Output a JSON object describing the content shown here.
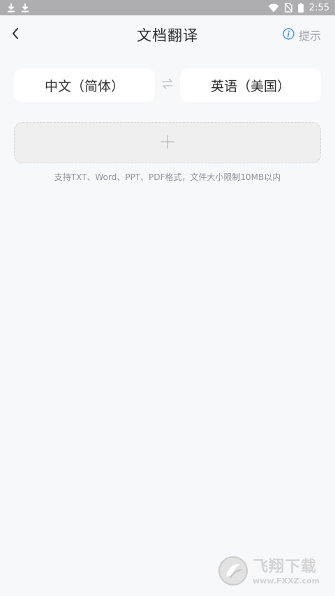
{
  "status_bar": {
    "time": "2:55",
    "left_icons": [
      "download-icon",
      "download-icon"
    ],
    "right_icons": [
      "wifi-icon",
      "no-sim-icon",
      "battery-icon"
    ]
  },
  "header": {
    "title": "文档翻译",
    "hint_label": "提示",
    "back_icon": "chevron-left-icon",
    "hint_icon": "info-icon"
  },
  "languages": {
    "source": "中文（简体）",
    "target": "英语（美国）",
    "swap_icon": "swap-icon"
  },
  "upload": {
    "icon": "plus-icon",
    "note": "支持TXT、Word、PPT、PDF格式，文件大小限制10MB以内"
  },
  "watermark": {
    "title": "飞翔下载",
    "url": "www.FXXZ.com"
  },
  "colors": {
    "background": "#f7f8fa",
    "status_bar": "#aeaeb0",
    "card": "#ffffff",
    "upload_bg": "#efefef",
    "accent_info": "#4a8ff7",
    "muted_text": "#8f939a"
  }
}
